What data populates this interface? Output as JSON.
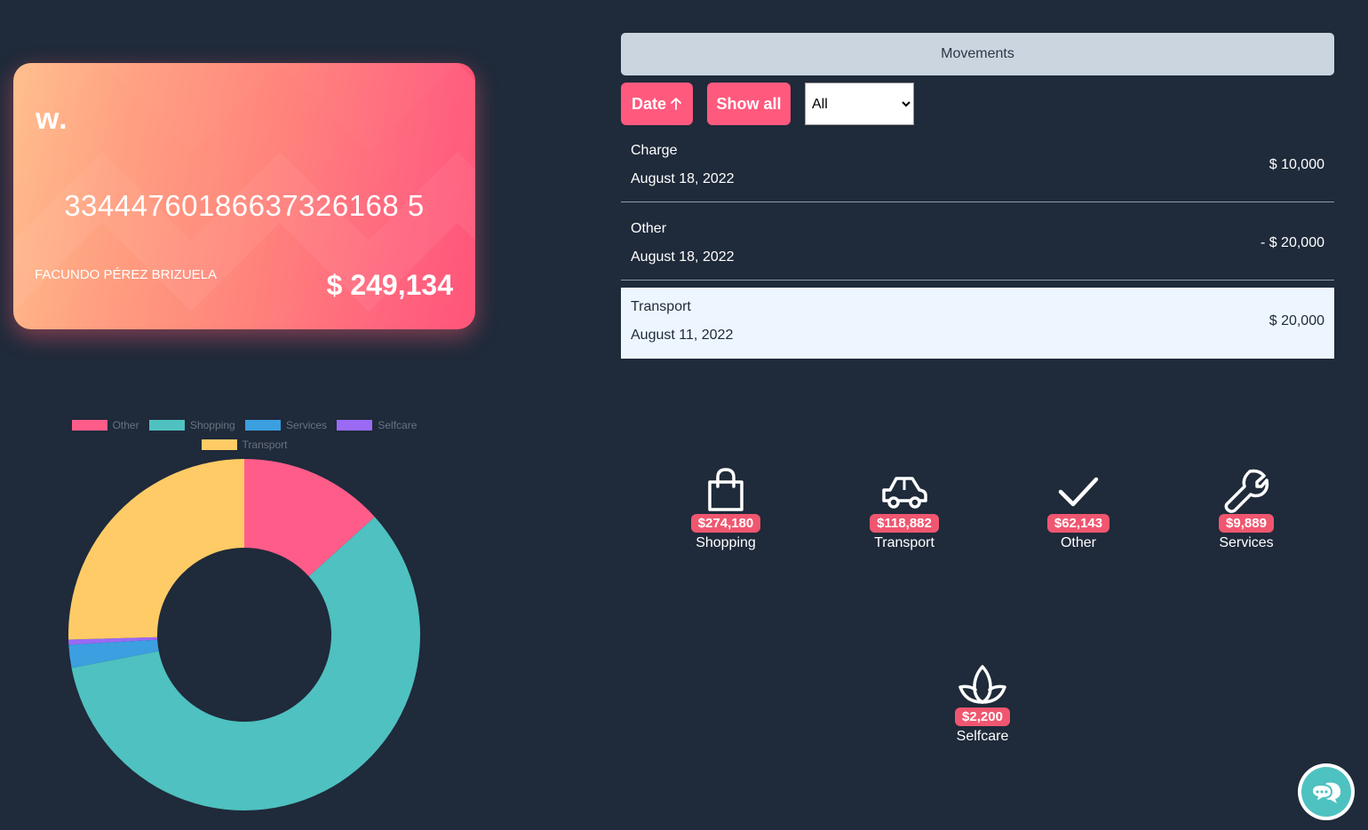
{
  "card": {
    "logo": "w.",
    "number": "33444760186637326168 5",
    "holder": "FACUNDO PÉREZ BRIZUELA",
    "balance": "$ 249,134"
  },
  "chart_data": {
    "type": "doughnut",
    "legend_position": "top",
    "series": [
      {
        "name": "Other",
        "value": 62143,
        "color": "#ff5c8a"
      },
      {
        "name": "Shopping",
        "value": 274180,
        "color": "#4fc1c0"
      },
      {
        "name": "Services",
        "value": 9889,
        "color": "#3b9fe0"
      },
      {
        "name": "Selfcare",
        "value": 2200,
        "color": "#9a6af5"
      },
      {
        "name": "Transport",
        "value": 118882,
        "color": "#ffcb66"
      }
    ]
  },
  "movements": {
    "title": "Movements",
    "sort_button": "Date",
    "show_all_button": "Show all",
    "filter": {
      "selected": "All",
      "options": [
        "All"
      ]
    },
    "rows": [
      {
        "type": "Charge",
        "date": "August 18, 2022",
        "amount": "$ 10,000"
      },
      {
        "type": "Other",
        "date": "August 18, 2022",
        "amount": "- $ 20,000"
      },
      {
        "type": "Transport",
        "date": "August 11, 2022",
        "amount": "$ 20,000"
      }
    ]
  },
  "categories": [
    {
      "label": "Shopping",
      "amount": "$274,180",
      "icon": "shopping-bag-icon"
    },
    {
      "label": "Transport",
      "amount": "$118,882",
      "icon": "car-icon"
    },
    {
      "label": "Other",
      "amount": "$62,143",
      "icon": "check-icon"
    },
    {
      "label": "Services",
      "amount": "$9,889",
      "icon": "wrench-icon"
    },
    {
      "label": "Selfcare",
      "amount": "$2,200",
      "icon": "lotus-icon"
    }
  ],
  "colors": {
    "background": "#1f2a3a",
    "accent": "#ff5a7e",
    "badge": "#f0566f"
  }
}
